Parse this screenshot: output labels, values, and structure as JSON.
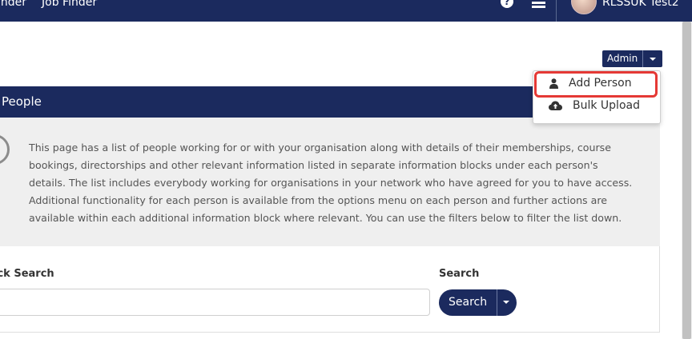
{
  "nav": {
    "links": [
      "inder",
      "Job Finder"
    ],
    "help_glyph": "?",
    "username": "RLSSUK Test2"
  },
  "admin": {
    "label": "Admin"
  },
  "dropdown": {
    "items": [
      {
        "label": "Add Person",
        "icon": "user-icon"
      },
      {
        "label": "Bulk Upload",
        "icon": "cloud-upload-icon"
      }
    ]
  },
  "panel": {
    "title": "People",
    "description": "This page has a list of people working for or with your organisation along with details of their memberships, course bookings, directorships and other relevant information listed in separate information blocks under each person's details. The list includes everybody working for organisations in your network who have agreed for you to have access. Additional functionality for each person is available from the options menu on each person and further actions are available within each additional information block where relevant. You can use the filters below to filter the list down."
  },
  "filters": {
    "quick_search_label": "ick Search",
    "quick_search_value": "",
    "search_label": "Search",
    "search_button": "Search"
  },
  "colors": {
    "brand": "#1b2a5e",
    "highlight": "#e53935",
    "info_bg": "#efefef"
  }
}
